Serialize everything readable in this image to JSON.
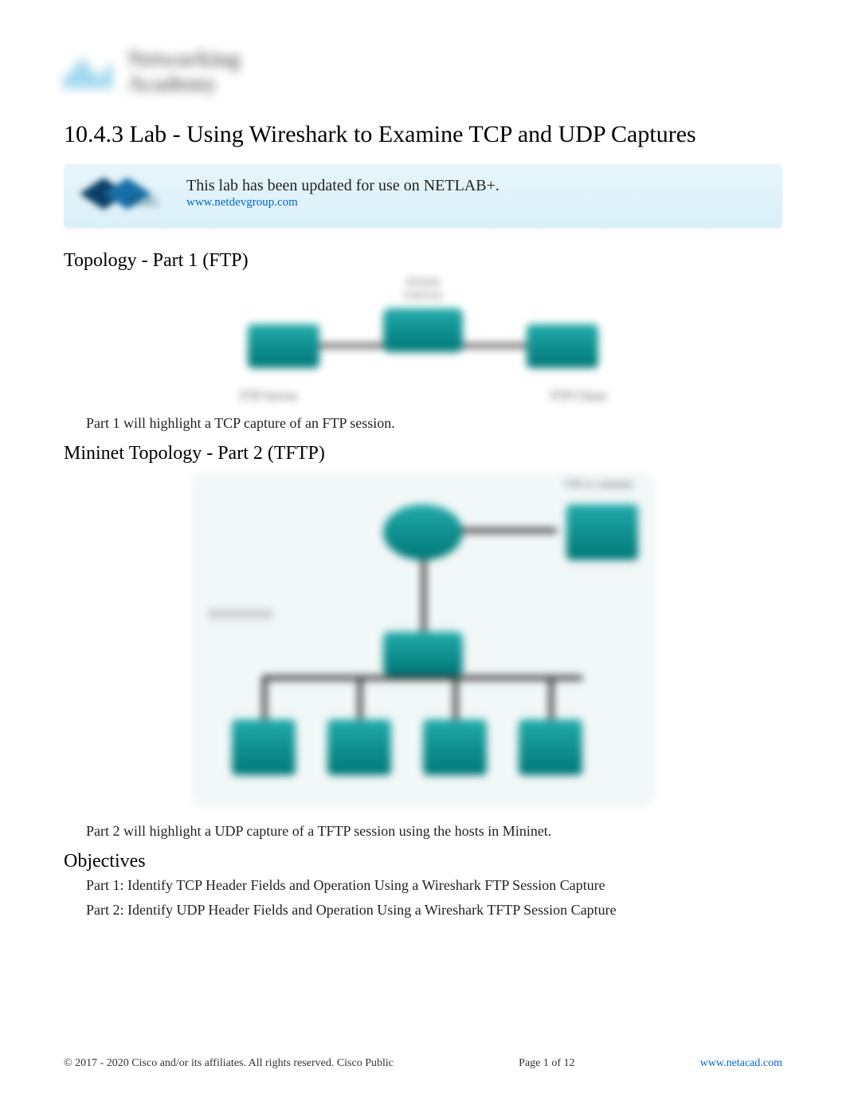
{
  "logo": {
    "brand_line1": "Networking",
    "brand_line2": "Academy",
    "cisco": "cisco"
  },
  "title": "10.4.3 Lab - Using Wireshark to Examine TCP and UDP Captures",
  "netlab": {
    "text": "This lab has been updated for use on NETLAB+.",
    "link_text": "www.netdevgroup.com",
    "link_href": "http://www.netdevgroup.com"
  },
  "sections": {
    "topology1_heading": "Topology - Part 1 (FTP)",
    "topology1_labels": {
      "top": "Default Gateway",
      "left": "FTP Server",
      "right": "FTP Client"
    },
    "part1_text": "Part 1 will highlight a TCP capture of an FTP session.",
    "topology2_heading": "Mininet Topology - Part 2 (TFTP)",
    "topology2_labels": {
      "vm": "VM w/ mininet",
      "left": "XXXXXXX"
    },
    "part2_text": "Part 2 will highlight a UDP capture of a TFTP session using the hosts in Mininet.",
    "objectives_heading": "Objectives",
    "objectives": [
      "Part 1: Identify TCP Header Fields and Operation Using a Wireshark FTP Session Capture",
      "Part 2: Identify UDP Header Fields and Operation Using a Wireshark TFTP Session Capture"
    ]
  },
  "footer": {
    "copyright": "© 2017 - 2020 Cisco and/or its affiliates. All rights reserved. Cisco Public",
    "page": "Page 1 of 12",
    "link_text": "www.netacad.com",
    "link_href": "http://www.netacad.com"
  }
}
